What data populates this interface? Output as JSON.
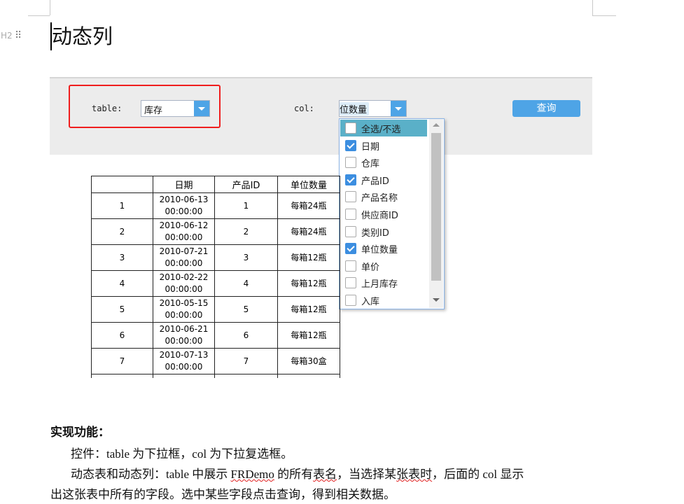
{
  "heading": {
    "level": "H2",
    "text": "动态列"
  },
  "form": {
    "table_label": "table:",
    "table_value": "库存",
    "col_label": "col:",
    "col_value": "位数量",
    "query_label": "查询",
    "options": [
      {
        "label": "全选/不选",
        "checked": false
      },
      {
        "label": "日期",
        "checked": true
      },
      {
        "label": "仓库",
        "checked": false
      },
      {
        "label": "产品ID",
        "checked": true
      },
      {
        "label": "产品名称",
        "checked": false
      },
      {
        "label": "供应商ID",
        "checked": false
      },
      {
        "label": "类别ID",
        "checked": false
      },
      {
        "label": "单位数量",
        "checked": true
      },
      {
        "label": "单价",
        "checked": false
      },
      {
        "label": "上月库存",
        "checked": false
      },
      {
        "label": "入库",
        "checked": false
      }
    ]
  },
  "table": {
    "headers": [
      "",
      "日期",
      "产品ID",
      "单位数量"
    ],
    "rows": [
      [
        "1",
        "2010-06-13",
        "00:00:00",
        "1",
        "每箱24瓶"
      ],
      [
        "2",
        "2010-06-12",
        "00:00:00",
        "2",
        "每箱24瓶"
      ],
      [
        "3",
        "2010-07-21",
        "00:00:00",
        "3",
        "每箱12瓶"
      ],
      [
        "4",
        "2010-02-22",
        "00:00:00",
        "4",
        "每箱12瓶"
      ],
      [
        "5",
        "2010-05-15",
        "00:00:00",
        "5",
        "每箱12瓶"
      ],
      [
        "6",
        "2010-06-21",
        "00:00:00",
        "6",
        "每箱12瓶"
      ],
      [
        "7",
        "2010-07-13",
        "00:00:00",
        "7",
        "每箱30盒"
      ]
    ]
  },
  "doc": {
    "section_title": "实现功能：",
    "p1": "控件：table 为下拉框，col 为下拉复选框。",
    "p2a": "动态表和动态列：table 中展示 ",
    "p2b": "FRDemo",
    "p2c": " 的所有",
    "p2d": "表名",
    "p2e": "，当选择某",
    "p2f": "张表时",
    "p2g": "，后面的 col 显示",
    "p3": "出这张表中所有的字段。选中某些字段点击查询，得到相关数据。"
  }
}
